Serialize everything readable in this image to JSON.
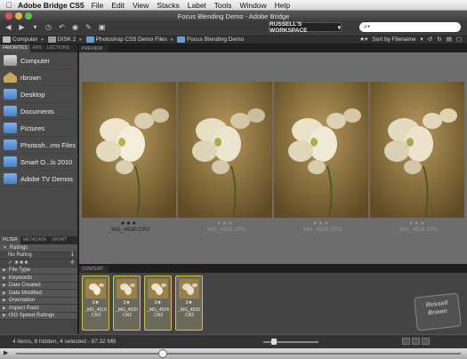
{
  "menubar": {
    "app_name": "Adobe Bridge CS5",
    "items": [
      "File",
      "Edit",
      "View",
      "Stacks",
      "Label",
      "Tools",
      "Window",
      "Help"
    ]
  },
  "window": {
    "title": "Focus Blending Demo - Adobe Bridge"
  },
  "toolbar": {
    "workspace_label": "RUSSELL'S WORKSPACE",
    "search_placeholder": "⌕▾"
  },
  "pathbar": {
    "crumbs": [
      "Computer",
      "DISK 2",
      "Photoshop CS5 Demo Files",
      "Focus Blending Demo"
    ],
    "sort_label": "Sort by Filename"
  },
  "left_panel": {
    "tabs": [
      "FAVORITES",
      "ERS",
      "LECTIONS"
    ],
    "favorites": [
      "Computer",
      "rbrown",
      "Desktop",
      "Documents",
      "Pictures",
      "Photosh...mo Files",
      "Smart O...ls 2010",
      "Adobe TV Demos"
    ],
    "filter_tabs": [
      "FILTER",
      "METADATA",
      "XPORT"
    ],
    "filters": {
      "ratings_header": "Ratings",
      "ratings": [
        {
          "label": "No Rating",
          "count": "1"
        },
        {
          "label": "★★★",
          "count": "4"
        }
      ],
      "categories": [
        "File Type",
        "Keywords",
        "Date Created",
        "Date Modified",
        "Orientation",
        "Aspect Ratio",
        "ISO Speed Ratings"
      ]
    }
  },
  "preview": {
    "label": "PREVIEW",
    "items": [
      {
        "stars": "★★★",
        "name": "_MG_4530.CR2"
      },
      {
        "stars": "★★★",
        "name": "_MG_4516.CR2"
      },
      {
        "stars": "★★★",
        "name": "_MG_4520.CR2"
      },
      {
        "stars": "★★★",
        "name": "_MG_4524.CR2"
      }
    ]
  },
  "content": {
    "label": "CONTENT",
    "thumbs": [
      {
        "stars": "3★",
        "name": "_MG_4516",
        "ext": ".CR2"
      },
      {
        "stars": "3★",
        "name": "_MG_4520",
        "ext": ".CR2"
      },
      {
        "stars": "3★",
        "name": "_MG_4524",
        "ext": ".CR2"
      },
      {
        "stars": "3★",
        "name": "_MG_4530",
        "ext": ".CR2"
      }
    ],
    "logo_text": "Russell Brown"
  },
  "status": {
    "text": "4 items, 8 hidden, 4 selected - 87.32 MB"
  },
  "colors": {
    "selection": "#d9b94a",
    "folder": "#6a9bd4",
    "preview_bg": "#6d6d6d"
  }
}
